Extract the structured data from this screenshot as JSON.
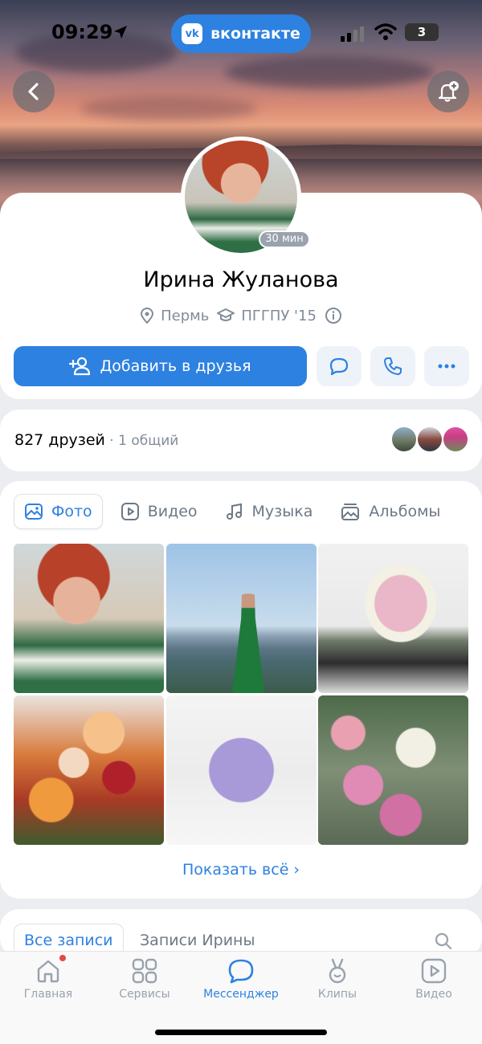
{
  "status_bar": {
    "time": "09:29",
    "battery": "3",
    "app_pill": "вконтакте",
    "vk_logo": "vk"
  },
  "header": {
    "back_icon": "chevron-left-icon",
    "bell_icon": "bell-plus-icon"
  },
  "profile": {
    "name": "Ирина Жуланова",
    "last_seen": "30 мин",
    "city": "Пермь",
    "university": "ПГГПУ '15",
    "add_friend_label": "Добавить в друзья"
  },
  "friends": {
    "count_label": "827 друзей",
    "mutual_label": " · 1 общий"
  },
  "media": {
    "tabs": [
      {
        "label": "Фото",
        "icon": "photo-icon"
      },
      {
        "label": "Видео",
        "icon": "video-icon"
      },
      {
        "label": "Музыка",
        "icon": "music-icon"
      },
      {
        "label": "Альбомы",
        "icon": "albums-icon"
      }
    ],
    "show_all": "Показать всё ›"
  },
  "posts": {
    "tabs": [
      "Все записи",
      "Записи Ирины"
    ]
  },
  "nav": {
    "items": [
      {
        "label": "Главная",
        "icon": "home-icon"
      },
      {
        "label": "Сервисы",
        "icon": "services-icon"
      },
      {
        "label": "Мессенджер",
        "icon": "messenger-icon"
      },
      {
        "label": "Клипы",
        "icon": "clips-icon"
      },
      {
        "label": "Видео",
        "icon": "video-icon"
      }
    ]
  },
  "colors": {
    "accent": "#2d81e0",
    "secondary_text": "#818c99",
    "background": "#ebedf0"
  }
}
